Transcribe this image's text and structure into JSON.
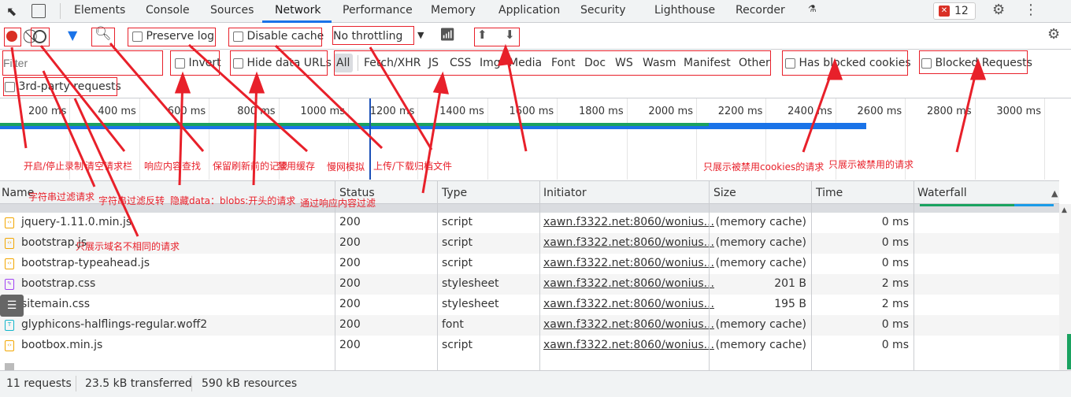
{
  "tabs": {
    "items": [
      "Elements",
      "Console",
      "Sources",
      "Network",
      "Performance",
      "Memory",
      "Application",
      "Security",
      "Lighthouse",
      "Recorder"
    ],
    "active": "Network",
    "error_count": "12"
  },
  "toolbar": {
    "preserve_log": "Preserve log",
    "disable_cache": "Disable cache",
    "throttling": "No throttling"
  },
  "filter": {
    "placeholder": "Filter",
    "invert": "Invert",
    "hide_data_urls": "Hide data URLs",
    "types": [
      "All",
      "Fetch/XHR",
      "JS",
      "CSS",
      "Img",
      "Media",
      "Font",
      "Doc",
      "WS",
      "Wasm",
      "Manifest",
      "Other"
    ],
    "has_blocked_cookies": "Has blocked cookies",
    "blocked_requests": "Blocked Requests",
    "third_party": "3rd-party requests"
  },
  "timeline": {
    "ticks": [
      "200 ms",
      "400 ms",
      "600 ms",
      "800 ms",
      "1000 ms",
      "1200 ms",
      "1400 ms",
      "1600 ms",
      "1800 ms",
      "2000 ms",
      "2200 ms",
      "2400 ms",
      "2600 ms",
      "2800 ms",
      "3000 ms"
    ]
  },
  "annotations": {
    "record": "开启/停止录制",
    "clear": "清空请求栏",
    "search": "响应内容查找",
    "preserve": "保留刷新前的记录",
    "disable_cache": "禁用缓存",
    "throttle": "慢网模拟",
    "upload_download": "上传/下载归档文件",
    "blocked_cookies": "只展示被禁用cookies的请求",
    "blocked_requests": "只展示被禁用的请求",
    "filter_string": "字符串过滤请求",
    "invert": "字符串过滤反转",
    "hide_data": "隐藏data：blobs:开头的请求",
    "type_filter": "通过响应内容过滤",
    "third_party": "只展示域名不相同的请求"
  },
  "table": {
    "headers": [
      "Name",
      "Status",
      "Type",
      "Initiator",
      "Size",
      "Time",
      "Waterfall"
    ],
    "rows": [
      {
        "name": "jquery-1.11.0.min.js",
        "status": "200",
        "type": "script",
        "initiator": "xawn.f3322.net:8060/wonius...",
        "size": "(memory cache)",
        "time": "0 ms",
        "icon": "script"
      },
      {
        "name": "bootstrap.js",
        "status": "200",
        "type": "script",
        "initiator": "xawn.f3322.net:8060/wonius...",
        "size": "(memory cache)",
        "time": "0 ms",
        "icon": "script"
      },
      {
        "name": "bootstrap-typeahead.js",
        "status": "200",
        "type": "script",
        "initiator": "xawn.f3322.net:8060/wonius...",
        "size": "(memory cache)",
        "time": "0 ms",
        "icon": "script"
      },
      {
        "name": "bootstrap.css",
        "status": "200",
        "type": "stylesheet",
        "initiator": "xawn.f3322.net:8060/wonius...",
        "size": "201 B",
        "time": "2 ms",
        "icon": "css"
      },
      {
        "name": "sitemain.css",
        "status": "200",
        "type": "stylesheet",
        "initiator": "xawn.f3322.net:8060/wonius...",
        "size": "195 B",
        "time": "2 ms",
        "icon": "css"
      },
      {
        "name": "glyphicons-halflings-regular.woff2",
        "status": "200",
        "type": "font",
        "initiator": "xawn.f3322.net:8060/wonius...",
        "size": "(memory cache)",
        "time": "0 ms",
        "icon": "font"
      },
      {
        "name": "bootbox.min.js",
        "status": "200",
        "type": "script",
        "initiator": "xawn.f3322.net:8060/wonius...",
        "size": "(memory cache)",
        "time": "0 ms",
        "icon": "script"
      }
    ]
  },
  "status": {
    "requests": "11 requests",
    "transferred": "23.5 kB transferred",
    "resources": "590 kB resources"
  },
  "colors": {
    "annotation": "#e8202a",
    "accent": "#1a73e8",
    "record": "#d93025"
  }
}
